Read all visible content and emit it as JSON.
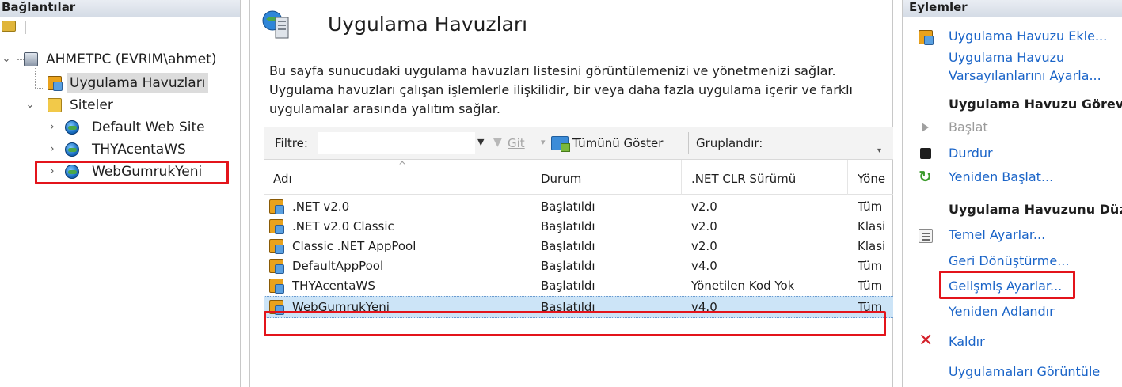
{
  "connections": {
    "header": "Bağlantılar",
    "tree": [
      {
        "label": "AHMETPC (EVRIM\\ahmet)"
      },
      {
        "label": "Uygulama Havuzları"
      },
      {
        "label": "Siteler"
      },
      {
        "label": "Default Web Site"
      },
      {
        "label": "THYAcentaWS"
      },
      {
        "label": "WebGumrukYeni"
      }
    ]
  },
  "main": {
    "title": "Uygulama Havuzları",
    "description": "Bu sayfa sunucudaki uygulama havuzları listesini görüntülemenizi ve yönetmenizi sağlar. Uygulama havuzları çalışan işlemlerle ilişkilidir, bir veya daha fazla uygulama içerir ve farklı uygulamalar arasında yalıtım sağlar.",
    "filterbar": {
      "filter_label": "Filtre:",
      "filter_value": "",
      "go_label": "Git",
      "show_all_label": "Tümünü Göster",
      "group_by_label": "Gruplandır:"
    },
    "columns": [
      "Adı",
      "Durum",
      ".NET CLR Sürümü",
      "Yöne"
    ],
    "rows": [
      {
        "name": ".NET v2.0",
        "status": "Başlatıldı",
        "clr": "v2.0",
        "mode": "Tüm"
      },
      {
        "name": ".NET v2.0 Classic",
        "status": "Başlatıldı",
        "clr": "v2.0",
        "mode": "Klasi"
      },
      {
        "name": "Classic .NET AppPool",
        "status": "Başlatıldı",
        "clr": "v2.0",
        "mode": "Klasi"
      },
      {
        "name": "DefaultAppPool",
        "status": "Başlatıldı",
        "clr": "v4.0",
        "mode": "Tüm"
      },
      {
        "name": "THYAcentaWS",
        "status": "Başlatıldı",
        "clr": "Yönetilen Kod Yok",
        "mode": "Tüm"
      },
      {
        "name": "WebGumrukYeni",
        "status": "Başlatıldı",
        "clr": "v4.0",
        "mode": "Tüm"
      }
    ]
  },
  "actions": {
    "header": "Eylemler",
    "add_pool": "Uygulama Havuzu Ekle...",
    "set_defaults_1": "Uygulama Havuzu",
    "set_defaults_2": "Varsayılanlarını Ayarla...",
    "section_tasks": "Uygulama Havuzu Görevleri",
    "start": "Başlat",
    "stop": "Durdur",
    "restart": "Yeniden Başlat...",
    "section_edit": "Uygulama Havuzunu Düzenle",
    "basic_settings": "Temel Ayarlar...",
    "recycling": "Geri Dönüştürme...",
    "advanced_settings": "Gelişmiş Ayarlar...",
    "rename": "Yeniden Adlandır",
    "remove": "Kaldır",
    "view_apps": "Uygulamaları Görüntüle"
  },
  "colors": {
    "highlight_box": "#e3141b",
    "link": "#1a64c8",
    "selected_row": "#cce4f7"
  }
}
